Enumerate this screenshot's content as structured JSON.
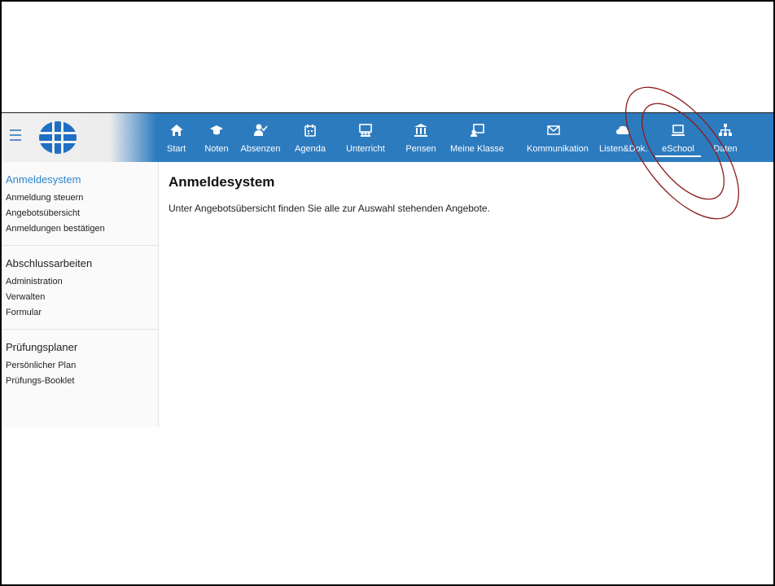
{
  "nav": {
    "items": [
      {
        "label": "Start",
        "icon": "home-icon"
      },
      {
        "label": "Noten",
        "icon": "graduation-cap-icon"
      },
      {
        "label": "Absenzen",
        "icon": "user-check-icon"
      },
      {
        "label": "Agenda",
        "icon": "calendar-icon"
      },
      {
        "label": "Unterricht",
        "icon": "classroom-icon"
      },
      {
        "label": "Pensen",
        "icon": "institution-icon"
      },
      {
        "label": "Meine Klasse",
        "icon": "teacher-board-icon"
      },
      {
        "label": "Kommunikation",
        "icon": "envelope-icon"
      },
      {
        "label": "Listen&Dok.",
        "icon": "cloud-icon"
      },
      {
        "label": "eSchool",
        "icon": "laptop-icon",
        "active": true
      },
      {
        "label": "Daten",
        "icon": "sitemap-icon"
      }
    ],
    "accent": "#2d7bbf"
  },
  "sidebar": {
    "sections": [
      {
        "title": "Anmeldesystem",
        "active": true,
        "links": [
          "Anmeldung steuern",
          "Angebotsübersicht",
          "Anmeldungen bestätigen"
        ]
      },
      {
        "title": "Abschlussarbeiten",
        "links": [
          "Administration",
          "Verwalten",
          "Formular"
        ]
      },
      {
        "title": "Prüfungsplaner",
        "links": [
          "Persönlicher Plan",
          "Prüfungs-Booklet"
        ]
      }
    ],
    "active_color": "#2c86cf"
  },
  "main": {
    "title": "Anmeldesystem",
    "text": "Unter Angebotsübersicht finden Sie alle zur Auswahl stehenden Angebote."
  },
  "annotation_color": "#8b1a1a"
}
